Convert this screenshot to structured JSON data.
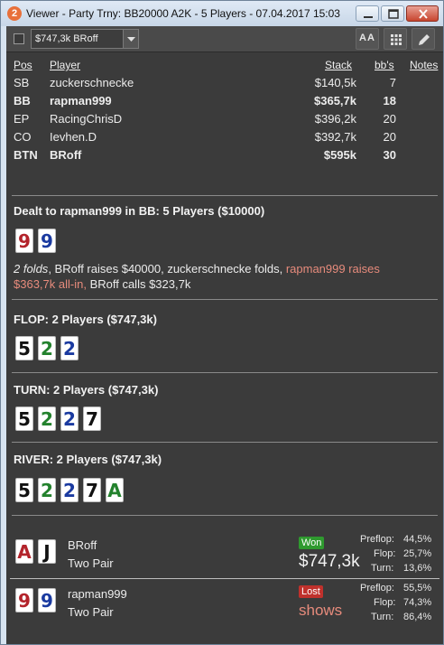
{
  "window": {
    "title": "Viewer - Party Trny: BB20000 A2K - 5 Players - 07.04.2017 15:03",
    "app_icon_text": "2"
  },
  "toolbar": {
    "combo_value": "$747,3k BRoff",
    "font_button_label": "AA"
  },
  "players_table": {
    "headers": {
      "pos": "Pos",
      "player": "Player",
      "stack": "Stack",
      "bbs": "bb's",
      "notes": "Notes"
    },
    "rows": [
      {
        "pos": "SB",
        "player": "zuckerschnecke",
        "stack": "$140,5k",
        "bbs": "7",
        "bold": false
      },
      {
        "pos": "BB",
        "player": "rapman999",
        "stack": "$365,7k",
        "bbs": "18",
        "bold": true
      },
      {
        "pos": "EP",
        "player": "RacingChrisD",
        "stack": "$396,2k",
        "bbs": "20",
        "bold": false
      },
      {
        "pos": "CO",
        "player": "Ievhen.D",
        "stack": "$392,7k",
        "bbs": "20",
        "bold": false
      },
      {
        "pos": "BTN",
        "player": "BRoff",
        "stack": "$595k",
        "bbs": "30",
        "bold": true
      }
    ]
  },
  "preflop": {
    "title": "Dealt to rapman999 in BB: 5 Players ($10000)",
    "hole_cards": [
      {
        "rank": "9",
        "suit": "heart"
      },
      {
        "rank": "9",
        "suit": "diamond"
      }
    ],
    "action_folds": "2 folds",
    "action_1": ", BRoff raises $40000, zuckerschnecke folds, ",
    "action_hl_1": "rapman999 raises",
    "action_hl_2": "$363,7k all-in,",
    "action_2": " BRoff calls $323,7k"
  },
  "flop": {
    "title": "FLOP: 2 Players ($747,3k)",
    "cards": [
      {
        "rank": "5",
        "suit": "spade"
      },
      {
        "rank": "2",
        "suit": "club"
      },
      {
        "rank": "2",
        "suit": "diamond"
      }
    ]
  },
  "turn": {
    "title": "TURN: 2 Players ($747,3k)",
    "cards": [
      {
        "rank": "5",
        "suit": "spade"
      },
      {
        "rank": "2",
        "suit": "club"
      },
      {
        "rank": "2",
        "suit": "diamond"
      },
      {
        "rank": "7",
        "suit": "spade"
      }
    ]
  },
  "river": {
    "title": "RIVER: 2 Players ($747,3k)",
    "cards": [
      {
        "rank": "5",
        "suit": "spade"
      },
      {
        "rank": "2",
        "suit": "club"
      },
      {
        "rank": "2",
        "suit": "diamond"
      },
      {
        "rank": "7",
        "suit": "spade"
      },
      {
        "rank": "A",
        "suit": "club"
      }
    ]
  },
  "results": [
    {
      "cards": [
        {
          "rank": "A",
          "suit": "heart"
        },
        {
          "rank": "J",
          "suit": "spade"
        }
      ],
      "name": "BRoff",
      "hand": "Two Pair",
      "badge": "Won",
      "amount": "$747,3k",
      "stats": [
        {
          "label": "Preflop:",
          "value": "44,5%"
        },
        {
          "label": "Flop:",
          "value": "25,7%"
        },
        {
          "label": "Turn:",
          "value": "13,6%"
        }
      ]
    },
    {
      "cards": [
        {
          "rank": "9",
          "suit": "heart"
        },
        {
          "rank": "9",
          "suit": "diamond"
        }
      ],
      "name": "rapman999",
      "hand": "Two Pair",
      "badge": "Lost",
      "amount": "shows",
      "stats": [
        {
          "label": "Preflop:",
          "value": "55,5%"
        },
        {
          "label": "Flop:",
          "value": "74,3%"
        },
        {
          "label": "Turn:",
          "value": "86,4%"
        }
      ]
    }
  ],
  "colors": {
    "heart": "#b3232b",
    "diamond": "#1a3aa0",
    "club": "#23822d",
    "spade": "#111111",
    "won_badge": "#2f9a2f",
    "lost_badge": "#c0312c",
    "highlight_text": "#e78b7c",
    "panel_bg": "#3b3b3b"
  }
}
